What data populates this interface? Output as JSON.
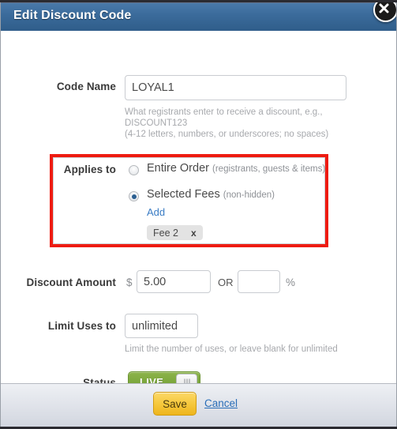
{
  "dialog": {
    "title": "Edit Discount Code",
    "close_icon": "close-icon"
  },
  "form": {
    "code_name": {
      "label": "Code Name",
      "value": "LOYAL1",
      "placeholder": "",
      "hint_line1": "What registrants enter to receive a discount, e.g.,",
      "hint_line2": "DISCOUNT123",
      "hint_line3": "(4-12 letters, numbers, or underscores; no spaces)"
    },
    "applies_to": {
      "label": "Applies to",
      "options": [
        {
          "main": "Entire Order",
          "sub": "(registrants, guests & items)",
          "selected": false
        },
        {
          "main": "Selected Fees",
          "sub": "(non-hidden)",
          "selected": true
        }
      ],
      "add_link": "Add",
      "fees": [
        {
          "label": "Fee 2",
          "remove": "x"
        }
      ],
      "highlight_color": "#ee1b11"
    },
    "discount_amount": {
      "label": "Discount Amount",
      "currency_symbol": "$",
      "amount_value": "5.00",
      "amount_placeholder": "",
      "or_label": "OR",
      "percent_value": "",
      "percent_placeholder": "",
      "percent_symbol": "%"
    },
    "limit_uses": {
      "label": "Limit Uses to",
      "value": "unlimited",
      "placeholder": "",
      "hint": "Limit the number of uses, or leave blank for unlimited"
    },
    "status": {
      "label": "Status",
      "toggle_text": "LIVE",
      "toggle_on": true,
      "toggle_color": "#7da83e"
    }
  },
  "footer": {
    "save_label": "Save",
    "cancel_label": "Cancel"
  }
}
